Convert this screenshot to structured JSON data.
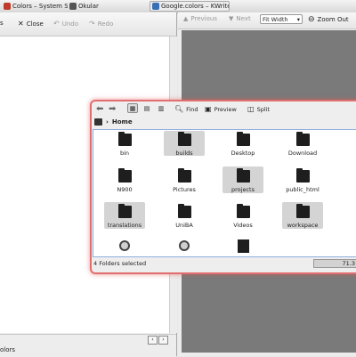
{
  "taskbar": {
    "tasks": [
      {
        "label": "Colors – System Setti",
        "icon": "colors-icon"
      },
      {
        "label": "Okular",
        "icon": "okular-icon"
      },
      {
        "label": "Google.colors – KWrite",
        "icon": "kwrite-icon"
      }
    ]
  },
  "left_window": {
    "toolbar": {
      "first_label": "s",
      "close_label": "Close",
      "undo_label": "Undo",
      "redo_label": "Redo"
    },
    "status_text": "olors"
  },
  "right_window": {
    "toolbar": {
      "previous_label": "Previous",
      "next_label": "Next",
      "fit_value": "Fit Width",
      "zoom_out_label": "Zoom Out"
    }
  },
  "file_dialog": {
    "toolbar": {
      "find_label": "Find",
      "preview_label": "Preview",
      "split_label": "Split"
    },
    "breadcrumb": {
      "current": "Home"
    },
    "items": [
      {
        "label": "bin",
        "kind": "folder",
        "selected": false
      },
      {
        "label": "builds",
        "kind": "folder",
        "selected": true
      },
      {
        "label": "Desktop",
        "kind": "folder",
        "selected": false
      },
      {
        "label": "Download",
        "kind": "folder",
        "selected": false
      },
      {
        "label": "N900",
        "kind": "folder-partial",
        "selected": false
      },
      {
        "label": "Pictures",
        "kind": "folder-partial",
        "selected": false
      },
      {
        "label": "projects",
        "kind": "folder",
        "selected": true
      },
      {
        "label": "public_html",
        "kind": "folder",
        "selected": false
      },
      {
        "label": "translations",
        "kind": "folder",
        "selected": true
      },
      {
        "label": "UniBA",
        "kind": "folder",
        "selected": false
      },
      {
        "label": "Videos",
        "kind": "folder",
        "selected": false
      },
      {
        "label": "workspace",
        "kind": "folder",
        "selected": true
      }
    ],
    "status_text": "4 Folders selected",
    "zoom_text": "71.3"
  }
}
